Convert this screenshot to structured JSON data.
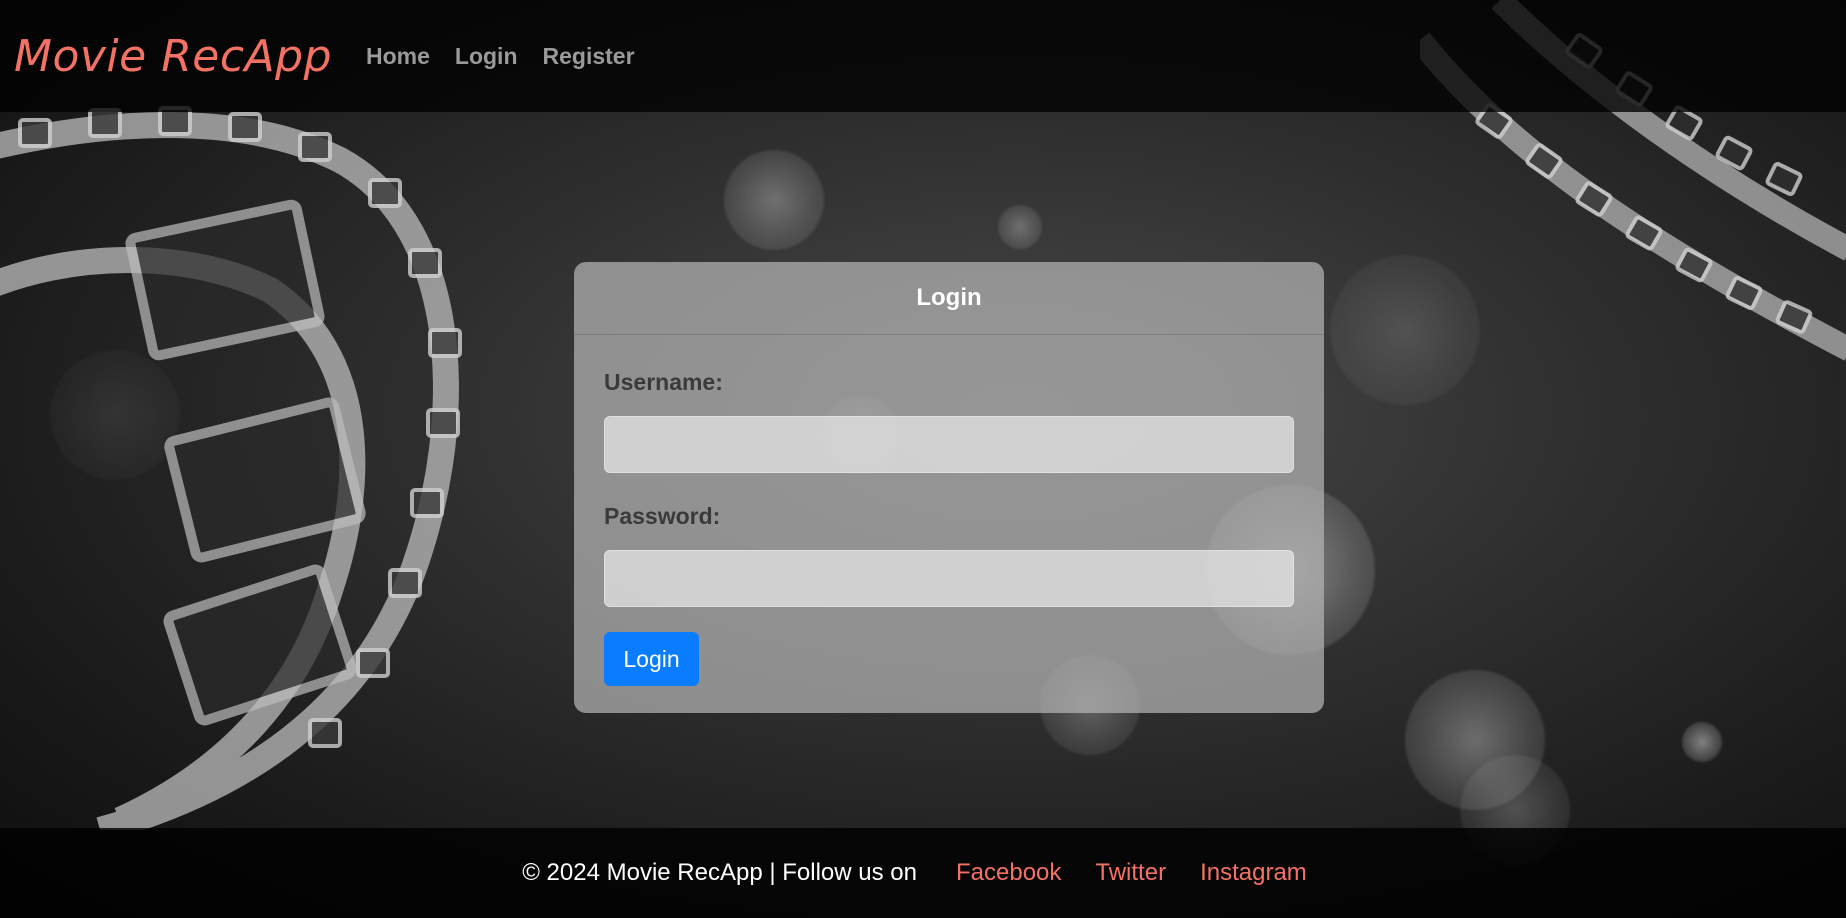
{
  "colors": {
    "brand": "#f47264",
    "accent_button": "#0a7cff",
    "nav_link": "#9a9a9a",
    "footer_link": "#f47264"
  },
  "navbar": {
    "brand": "Movie RecApp",
    "links": [
      "Home",
      "Login",
      "Register"
    ]
  },
  "login_card": {
    "title": "Login",
    "username_label": "Username:",
    "username_value": "",
    "password_label": "Password:",
    "password_value": "",
    "submit_label": "Login"
  },
  "footer": {
    "text": "© 2024 Movie RecApp | Follow us on",
    "links": [
      "Facebook",
      "Twitter",
      "Instagram"
    ]
  },
  "background": {
    "icons": [
      "film-strip-icon",
      "film-strip-icon",
      "bokeh-light"
    ]
  }
}
